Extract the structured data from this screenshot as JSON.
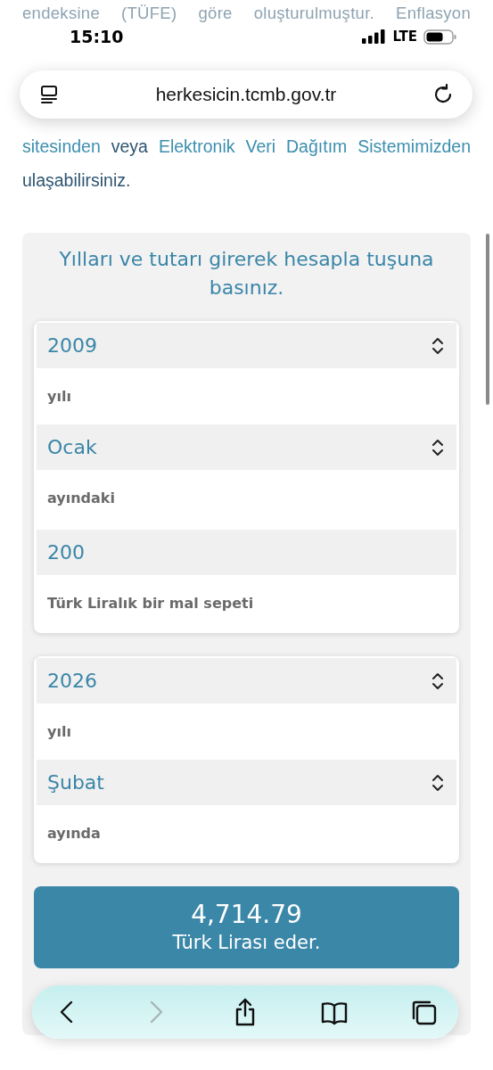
{
  "status_bar": {
    "time": "15:10",
    "network": "LTE"
  },
  "address_bar": {
    "url": "herkesicin.tcmb.gov.tr"
  },
  "intro": {
    "faded_lines": [
      "endeksine (TÜFE) göre oluşturulmuştur. Enflasyon"
    ],
    "parts": [
      {
        "text": "sitesinden",
        "link": true
      },
      {
        "text": "veya",
        "link": false
      },
      {
        "text": "Elektronik Veri Dağıtım Sistemimizden",
        "link": true
      },
      {
        "text": "ulaşabilirsiniz.",
        "link": false
      }
    ]
  },
  "calculator": {
    "title": "Yılları ve tutarı girerek hesapla tuşuna basınız.",
    "groups": [
      {
        "fields": [
          {
            "kind": "select",
            "value": "2009"
          },
          {
            "kind": "caption",
            "text": "yılı"
          },
          {
            "kind": "select",
            "value": "Ocak"
          },
          {
            "kind": "caption",
            "text": "ayındaki"
          },
          {
            "kind": "input",
            "value": "200"
          },
          {
            "kind": "caption",
            "text": "Türk Liralık bir mal sepeti"
          }
        ]
      },
      {
        "fields": [
          {
            "kind": "select",
            "value": "2026"
          },
          {
            "kind": "caption",
            "text": "yılı"
          },
          {
            "kind": "select",
            "value": "Şubat"
          },
          {
            "kind": "caption",
            "text": "ayında"
          }
        ]
      }
    ],
    "result": {
      "amount": "4,714.79",
      "caption": "Türk Lirası eder."
    }
  },
  "toolbar": [
    {
      "kind": "back",
      "disabled": false
    },
    {
      "kind": "forward",
      "disabled": true
    },
    {
      "kind": "share",
      "disabled": false
    },
    {
      "kind": "bookmarks",
      "disabled": false
    },
    {
      "kind": "tabs",
      "disabled": false
    }
  ]
}
